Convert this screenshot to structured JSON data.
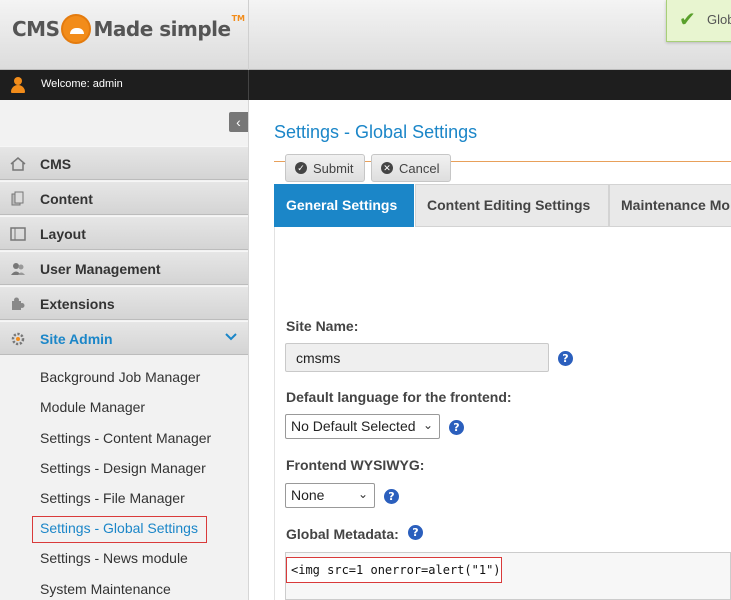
{
  "header": {
    "logo_left": "CMS",
    "logo_right": "Made simple",
    "logo_tm": "TM",
    "notice_text": "Glob"
  },
  "welcome": {
    "text": "Welcome: admin"
  },
  "sidebar": {
    "items": [
      {
        "label": "CMS",
        "icon": "house-icon"
      },
      {
        "label": "Content",
        "icon": "documents-icon"
      },
      {
        "label": "Layout",
        "icon": "layout-icon"
      },
      {
        "label": "User Management",
        "icon": "users-icon"
      },
      {
        "label": "Extensions",
        "icon": "puzzle-icon"
      },
      {
        "label": "Site Admin",
        "icon": "gear-icon",
        "active": true
      }
    ],
    "subitems": [
      "Background Job Manager",
      "Module Manager",
      "Settings - Content Manager",
      "Settings - Design Manager",
      "Settings - File Manager",
      "Settings - Global Settings",
      "Settings - News module",
      "System Maintenance"
    ]
  },
  "main": {
    "title": "Settings - Global Settings",
    "tabs": [
      "General Settings",
      "Content Editing Settings",
      "Maintenance Mo"
    ],
    "buttons": {
      "submit": "Submit",
      "cancel": "Cancel"
    },
    "site_name_label": "Site Name:",
    "site_name_value": "cmsms",
    "language_label": "Default language for the frontend:",
    "language_value": "No Default Selected",
    "wysiwyg_label": "Frontend WYSIWYG:",
    "wysiwyg_value": "None",
    "metadata_label": "Global Metadata:",
    "metadata_value": "<img src=1 onerror=alert(\"1\")",
    "help_glyph": "?"
  },
  "colors": {
    "accent": "#1b86c8",
    "brand_orange": "#f28c1a",
    "highlight_red": "#d93a3a"
  }
}
